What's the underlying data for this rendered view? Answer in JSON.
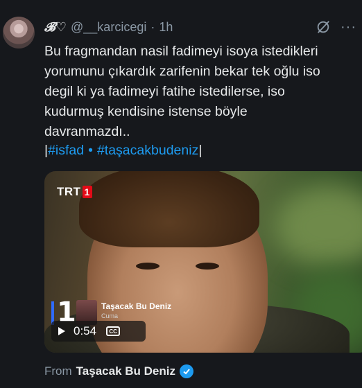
{
  "tweet": {
    "author_name": "𝓑♡",
    "handle": "@__karcicegi",
    "separator": "·",
    "time": "1h",
    "more_label": "···",
    "text": "Bu fragmandan nasil fadimeyi isoya istedikleri\nyorumunu çıkardık zarifenin bekar tek oğlu iso\ndegil ki ya fadimeyi fatihe istedilerse, iso\nkudurmuş kendisine istense böyle\ndavranmazdı..",
    "tag_open": "|",
    "hashtags": [
      "#isfad",
      "#taşacakbudeniz"
    ],
    "tag_separator": "•",
    "tag_close": "|"
  },
  "media": {
    "channel_logo_text": "TRT",
    "channel_logo_number": "1",
    "promo_number": "1",
    "promo_title": "Taşacak Bu Deniz",
    "promo_day": "Cuma",
    "duration": "0:54",
    "cc_label": "CC"
  },
  "source": {
    "label": "From",
    "account": "Taşacak Bu Deniz"
  },
  "colors": {
    "background": "#16181c",
    "accent": "#1d9bf0",
    "text": "#e7e9ea",
    "muted": "#8b98a5"
  },
  "icons": {
    "grok": "grok-icon",
    "verified": "verified-badge-icon",
    "play": "play-icon",
    "captions": "closed-captions-icon"
  }
}
